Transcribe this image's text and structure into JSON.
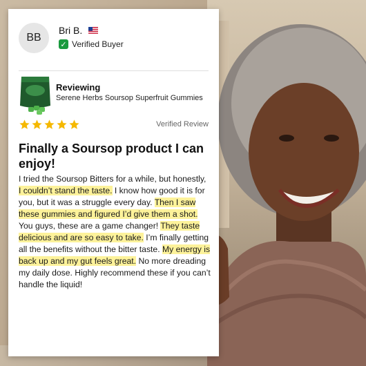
{
  "reviewer": {
    "initials": "BB",
    "name": "Bri B.",
    "verified_label": "Verified Buyer"
  },
  "product": {
    "reviewing_label": "Reviewing",
    "name": "Serene Herbs Soursop Superfruit Gummies"
  },
  "rating": {
    "stars": 5,
    "verified_review_label": "Verified Review",
    "star_color": "#f5b800"
  },
  "review": {
    "title": "Finally a Soursop product I can enjoy!",
    "segments": [
      {
        "text": "I tried the Soursop Bitters for a while, but honestly, ",
        "highlight": false
      },
      {
        "text": "I couldn’t stand the taste.",
        "highlight": true
      },
      {
        "text": " I know how good it is for you, but it was a struggle every day. ",
        "highlight": false
      },
      {
        "text": "Then I saw these gummies and figured I’d give them a shot.",
        "highlight": true
      },
      {
        "text": " You guys, these are a game changer! ",
        "highlight": false
      },
      {
        "text": "They taste delicious and are so easy to take.",
        "highlight": true
      },
      {
        "text": " I’m finally getting all the benefits without the bitter taste. ",
        "highlight": false
      },
      {
        "text": "My energy is back up and my gut feels great.",
        "highlight": true
      },
      {
        "text": " No more dreading my daily dose. Highly recommend these if you can’t handle the liquid!",
        "highlight": false
      }
    ]
  },
  "colors": {
    "highlight": "#fdf29a",
    "verified_check": "#1a9a3e"
  }
}
